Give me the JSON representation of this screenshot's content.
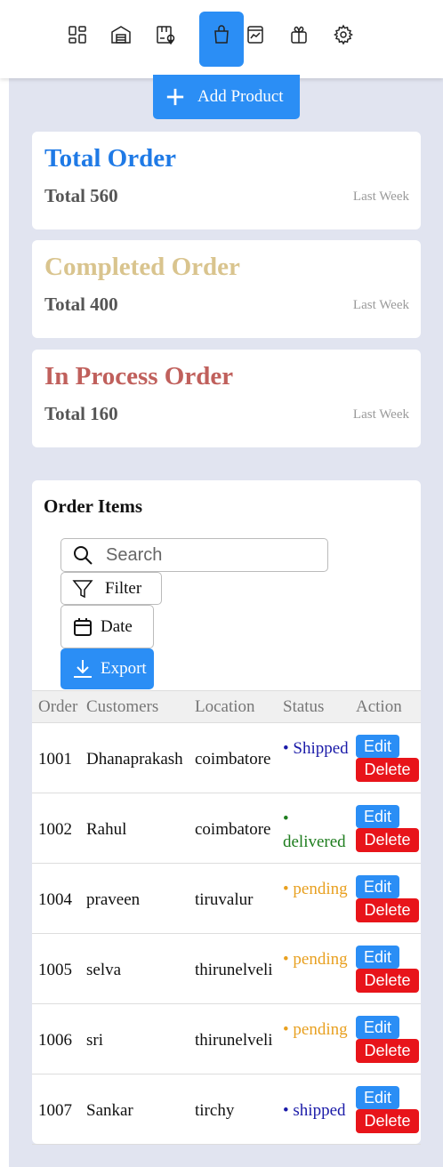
{
  "nav": {
    "items": [
      {
        "icon": "dashboard-icon"
      },
      {
        "icon": "warehouse-icon"
      },
      {
        "icon": "delivery-box-icon"
      },
      {
        "icon": "shopping-bag-icon",
        "active": true
      },
      {
        "icon": "analytics-icon"
      },
      {
        "icon": "gift-icon"
      },
      {
        "icon": "gear-icon"
      }
    ],
    "accent": "#2b8ef5"
  },
  "toolbar": {
    "add_product_label": "Add Product"
  },
  "summary": [
    {
      "title": "Total Order",
      "total": "Total 560",
      "period": "Last Week",
      "color": "#1f7ae6"
    },
    {
      "title": "Completed Order",
      "total": "Total 400",
      "period": "Last Week",
      "color": "#d9c48e"
    },
    {
      "title": "In Process Order",
      "total": "Total 160",
      "period": "Last Week",
      "color": "#c0605c"
    }
  ],
  "orders": {
    "title": "Order Items",
    "search_placeholder": "Search",
    "filter_label": "Filter",
    "date_label": "Date",
    "export_label": "Export",
    "columns": [
      "Order",
      "Customers",
      "Location",
      "Status",
      "Action"
    ],
    "edit_label": "Edit",
    "delete_label": "Delete",
    "rows": [
      {
        "order": "1001",
        "customer": "Dhanaprakash",
        "location": "coimbatore",
        "status": "• Shipped",
        "status_color": "#1a1aa8"
      },
      {
        "order": "1002",
        "customer": "Rahul",
        "location": "coimbatore",
        "status": "• delivered",
        "status_color": "#1e7d1e"
      },
      {
        "order": "1004",
        "customer": "praveen",
        "location": "tiruvalur",
        "status": "• pending",
        "status_color": "#e8a020"
      },
      {
        "order": "1005",
        "customer": "selva",
        "location": "thirunelveli",
        "status": "• pending",
        "status_color": "#e8a020"
      },
      {
        "order": "1006",
        "customer": "sri",
        "location": "thirunelveli",
        "status": "• pending",
        "status_color": "#e8a020"
      },
      {
        "order": "1007",
        "customer": "Sankar",
        "location": "tirchy",
        "status": "• shipped",
        "status_color": "#1a1aa8"
      }
    ]
  }
}
